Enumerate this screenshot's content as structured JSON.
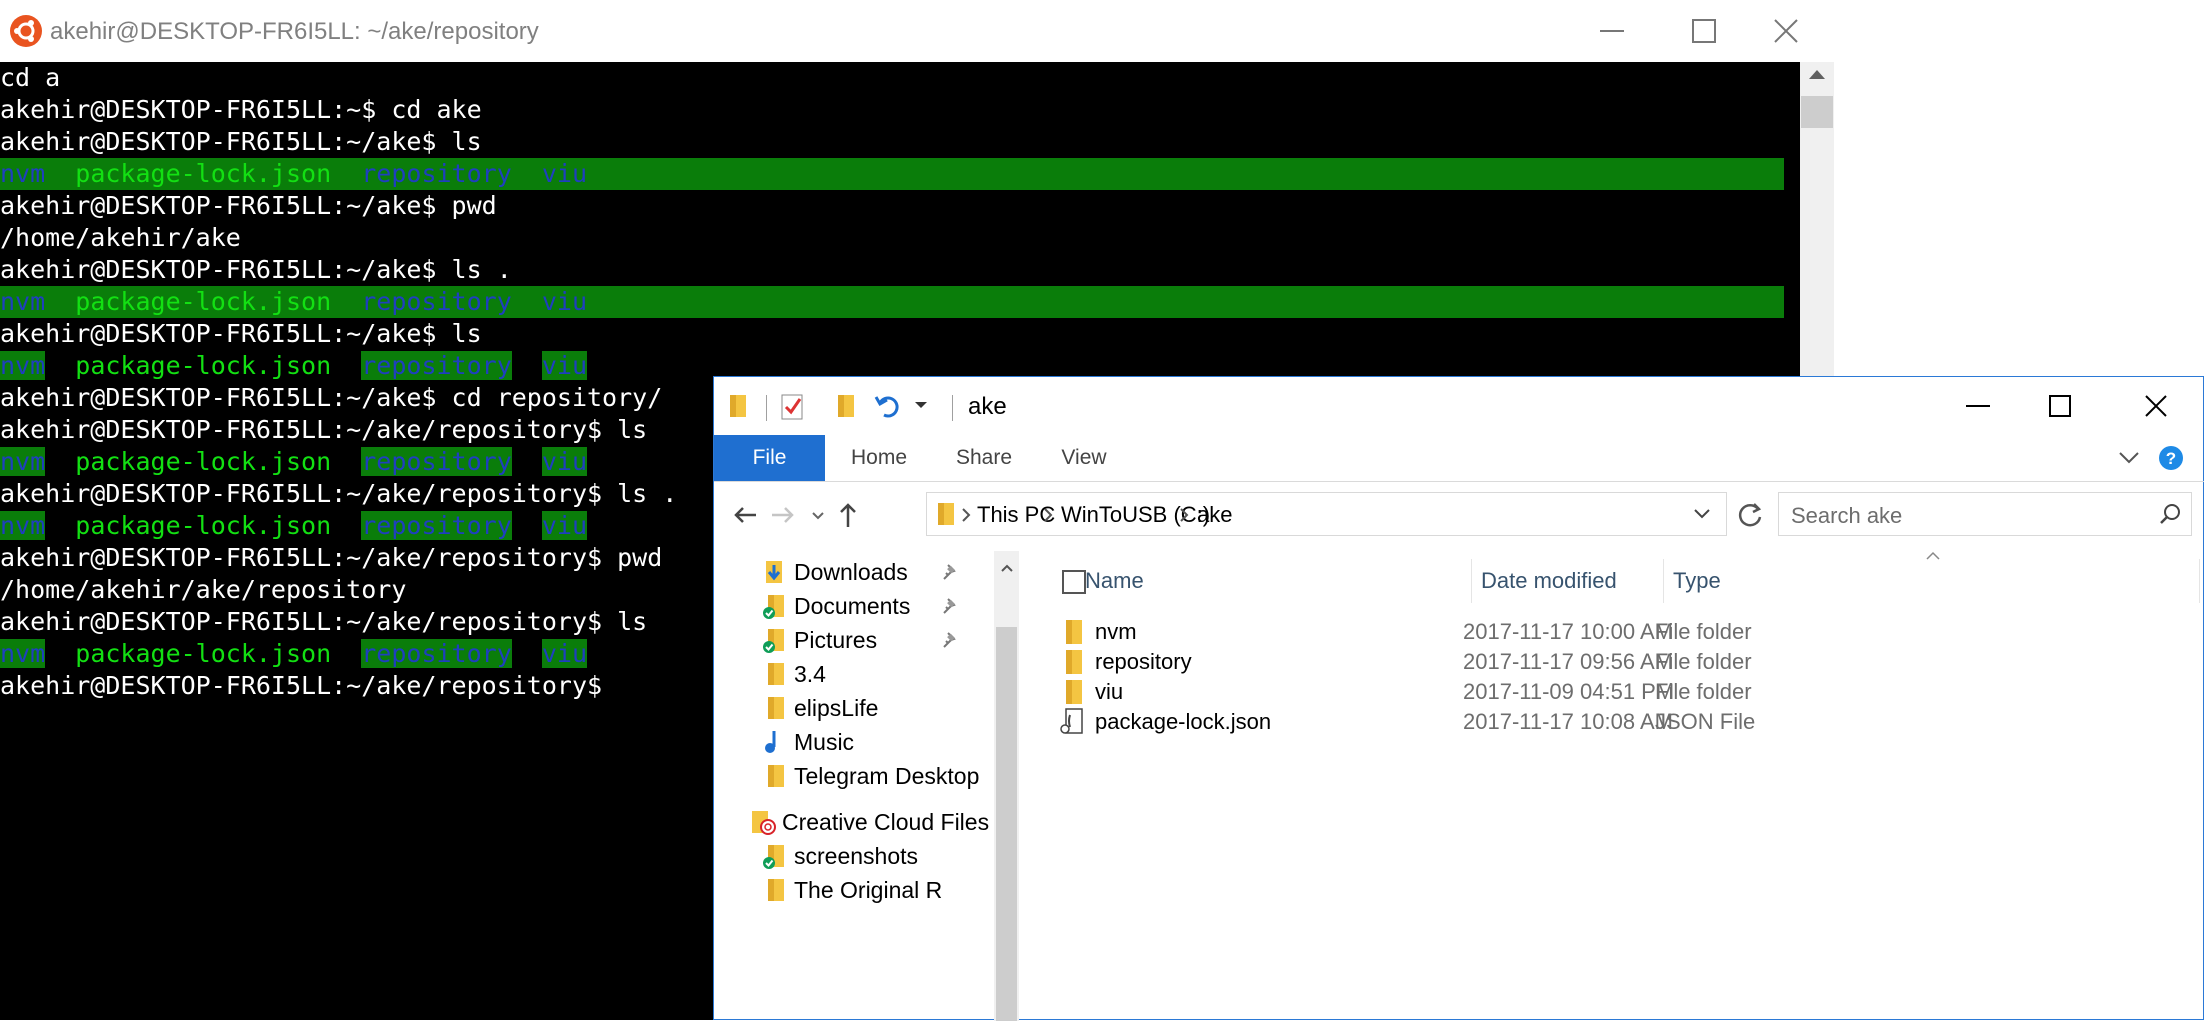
{
  "terminal": {
    "title": "akehir@DESKTOP-FR6I5LL: ~/ake/repository",
    "icon": "ubuntu-icon",
    "lines": [
      {
        "kind": "plain",
        "text": "cd a"
      },
      {
        "kind": "plain",
        "text": "akehir@DESKTOP-FR6I5LL:~$ cd ake"
      },
      {
        "kind": "plain",
        "text": "akehir@DESKTOP-FR6I5LL:~/ake$ ls"
      },
      {
        "kind": "ls",
        "full": true,
        "items": [
          "nvm",
          "package-lock.json",
          "repository",
          "viu"
        ]
      },
      {
        "kind": "plain",
        "text": "akehir@DESKTOP-FR6I5LL:~/ake$ pwd"
      },
      {
        "kind": "plain",
        "text": "/home/akehir/ake"
      },
      {
        "kind": "plain",
        "text": "akehir@DESKTOP-FR6I5LL:~/ake$ ls ."
      },
      {
        "kind": "ls",
        "full": true,
        "items": [
          "nvm",
          "package-lock.json",
          "repository",
          "viu"
        ]
      },
      {
        "kind": "plain",
        "text": "akehir@DESKTOP-FR6I5LL:~/ake$ ls"
      },
      {
        "kind": "ls",
        "full": false,
        "items": [
          "nvm",
          "package-lock.json",
          "repository",
          "viu"
        ]
      },
      {
        "kind": "plain",
        "text": "akehir@DESKTOP-FR6I5LL:~/ake$ cd repository/"
      },
      {
        "kind": "plain",
        "text": "akehir@DESKTOP-FR6I5LL:~/ake/repository$ ls"
      },
      {
        "kind": "ls",
        "full": false,
        "items": [
          "nvm",
          "package-lock.json",
          "repository",
          "viu"
        ]
      },
      {
        "kind": "plain",
        "text": "akehir@DESKTOP-FR6I5LL:~/ake/repository$ ls ."
      },
      {
        "kind": "ls",
        "full": false,
        "items": [
          "nvm",
          "package-lock.json",
          "repository",
          "viu"
        ]
      },
      {
        "kind": "plain",
        "text": "akehir@DESKTOP-FR6I5LL:~/ake/repository$ pwd"
      },
      {
        "kind": "plain",
        "text": "/home/akehir/ake/repository"
      },
      {
        "kind": "plain",
        "text": "akehir@DESKTOP-FR6I5LL:~/ake/repository$ ls"
      },
      {
        "kind": "ls",
        "full": false,
        "items": [
          "nvm",
          "package-lock.json",
          "repository",
          "viu"
        ]
      },
      {
        "kind": "plain",
        "text": "akehir@DESKTOP-FR6I5LL:~/ake/repository$ "
      }
    ]
  },
  "explorer": {
    "title": "ake",
    "tabs": {
      "file": "File",
      "home": "Home",
      "share": "Share",
      "view": "View"
    },
    "breadcrumb": [
      "This PC",
      "WinToUSB (C:)",
      "ake"
    ],
    "search_placeholder": "Search ake",
    "nav_items": [
      {
        "label": "Downloads",
        "icon": "downloads-folder-icon",
        "pinned": true
      },
      {
        "label": "Documents",
        "icon": "documents-folder-icon",
        "pinned": true
      },
      {
        "label": "Pictures",
        "icon": "pictures-folder-icon",
        "pinned": true
      },
      {
        "label": "3.4",
        "icon": "folder-icon",
        "pinned": false
      },
      {
        "label": "elipsLife",
        "icon": "folder-icon",
        "pinned": false
      },
      {
        "label": "Music",
        "icon": "music-folder-icon",
        "pinned": false
      },
      {
        "label": "Telegram Desktop",
        "icon": "folder-icon",
        "pinned": false
      },
      {
        "label": "Creative Cloud Files",
        "icon": "creative-cloud-icon",
        "pinned": false
      },
      {
        "label": "screenshots",
        "icon": "synced-folder-icon",
        "pinned": false
      },
      {
        "label": "The Original R",
        "icon": "folder-icon",
        "pinned": false
      }
    ],
    "columns": {
      "name": "Name",
      "date": "Date modified",
      "type": "Type"
    },
    "files": [
      {
        "name": "nvm",
        "date": "2017-11-17 10:00 AM",
        "type": "File folder",
        "icon": "folder-icon"
      },
      {
        "name": "repository",
        "date": "2017-11-17 09:56 AM",
        "type": "File folder",
        "icon": "folder-icon"
      },
      {
        "name": "viu",
        "date": "2017-11-09 04:51 PM",
        "type": "File folder",
        "icon": "folder-icon"
      },
      {
        "name": "package-lock.json",
        "date": "2017-11-17 10:08 AM",
        "type": "JSON File",
        "icon": "json-file-icon"
      }
    ]
  },
  "colors": {
    "terminal_bg": "#000000",
    "ls_green": "#13e013",
    "ls_highlight": "#0a7d0a",
    "ls_dir_text": "#1f3fbf",
    "accent": "#1f6fd0",
    "help_blue": "#1e8ae6"
  }
}
